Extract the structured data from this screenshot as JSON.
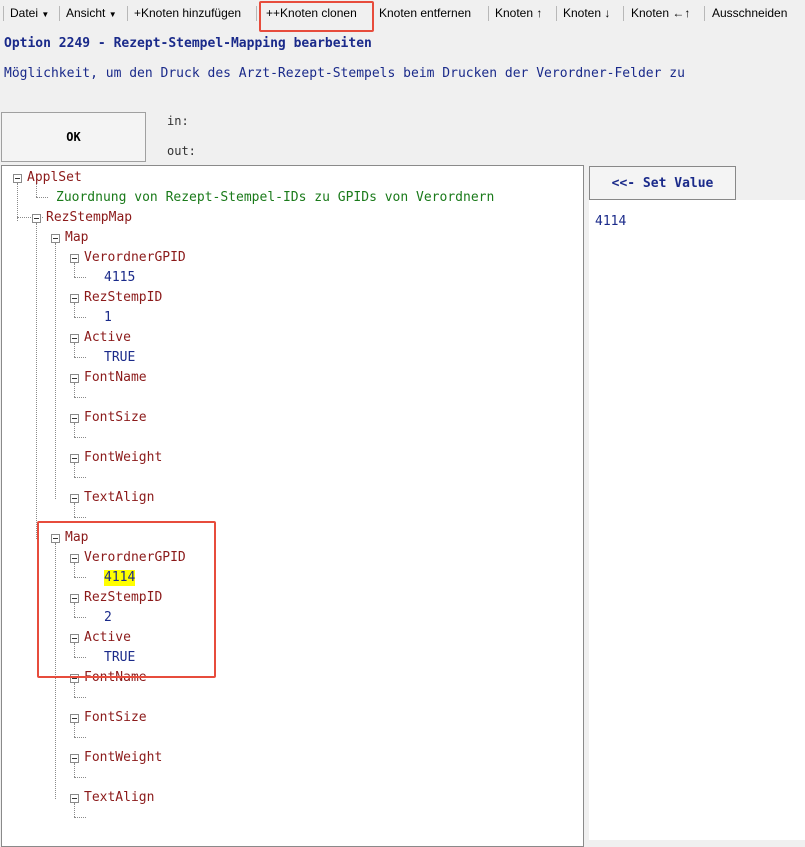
{
  "toolbar": {
    "file": "Datei",
    "view": "Ansicht",
    "add_node": "+Knoten hinzufügen",
    "clone_node": "++Knoten clonen",
    "remove_node": "Knoten entfernen",
    "node_up": "Knoten ↑",
    "node_down": "Knoten ↓",
    "node_left": "Knoten ←↑",
    "cut": "Ausschneiden"
  },
  "header": {
    "title": "Option 2249 - Rezept-Stempel-Mapping bearbeiten",
    "description": "Möglichkeit, um den Druck des Arzt-Rezept-Stempels beim Drucken der Verordner-Felder zu"
  },
  "ok_label": "OK",
  "in_label": "in:",
  "out_label": "out:",
  "set_value_label": "<<- Set Value",
  "right_value": "4114",
  "tree": {
    "root": "ApplSet",
    "comment": "Zuordnung von Rezept-Stempel-IDs zu GPIDs von Verordnern",
    "rezstempmap": "RezStempMap",
    "maps": [
      {
        "label": "Map",
        "fields": [
          {
            "name": "VerordnerGPID",
            "value": "4115"
          },
          {
            "name": "RezStempID",
            "value": "1"
          },
          {
            "name": "Active",
            "value": "TRUE"
          },
          {
            "name": "FontName",
            "value": ""
          },
          {
            "name": "FontSize",
            "value": ""
          },
          {
            "name": "FontWeight",
            "value": ""
          },
          {
            "name": "TextAlign",
            "value": ""
          }
        ]
      },
      {
        "label": "Map",
        "fields": [
          {
            "name": "VerordnerGPID",
            "value": "4114"
          },
          {
            "name": "RezStempID",
            "value": "2"
          },
          {
            "name": "Active",
            "value": "TRUE"
          },
          {
            "name": "FontName",
            "value": ""
          },
          {
            "name": "FontSize",
            "value": ""
          },
          {
            "name": "FontWeight",
            "value": ""
          },
          {
            "name": "TextAlign",
            "value": ""
          }
        ]
      }
    ]
  },
  "colors": {
    "highlight_border": "#e74c3c",
    "tag_text": "#8b1a1a",
    "value_text": "#1a2a8a",
    "comment_text": "#1a7a1a",
    "selection": "#ffff00"
  }
}
